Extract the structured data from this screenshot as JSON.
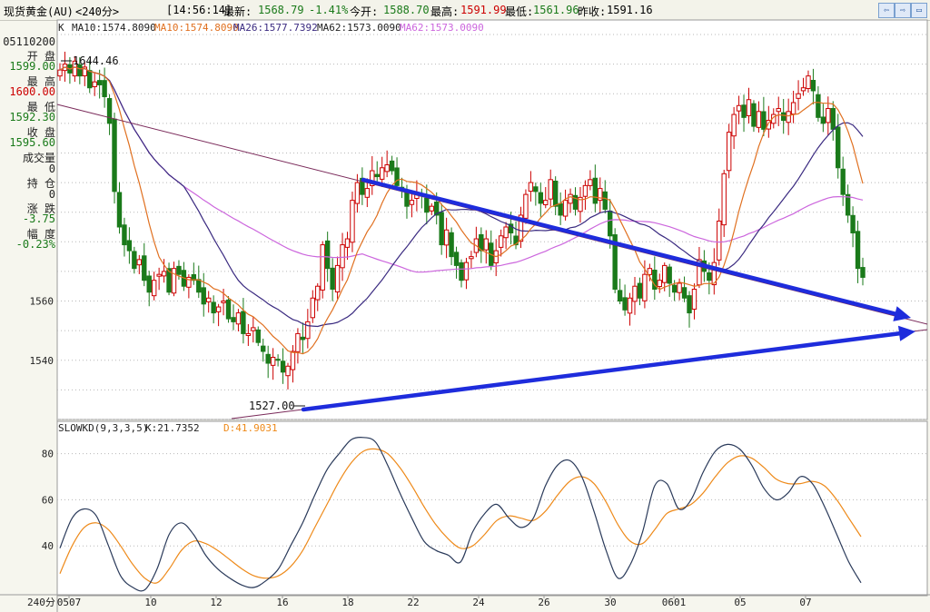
{
  "header": {
    "symbol": "现货黄金(AU)",
    "period": "<240分>",
    "time": "[14:56:14]",
    "latest_label": "最新:",
    "latest_value": "1568.79",
    "change_pct": "-1.41%",
    "open_label": "今开:",
    "open_value": "1588.70",
    "high_label": "最高:",
    "high_value": "1591.99",
    "low_label": "最低:",
    "low_value": "1561.96",
    "prev_label": "昨收:",
    "prev_value": "1591.16",
    "buttons": [
      "⇦",
      "⇨",
      "▭"
    ]
  },
  "info": {
    "date": "05110200",
    "open_label": "开 盘",
    "open": "1599.00",
    "high_label": "最 高",
    "high": "1600.00",
    "low_label": "最 低",
    "low": "1592.30",
    "close_label": "收 盘",
    "close": "1595.60",
    "volume_label": "成交量",
    "volume": "0",
    "position_label": "持 仓",
    "position": "0",
    "change_label": "涨 跌",
    "change": "-3.75",
    "range_label": "幅 度",
    "range": "-0.23%"
  },
  "period_label": "240分",
  "chart_data": [
    {
      "type": "candlestick",
      "legend": [
        {
          "text": "K",
          "color": "#222222"
        },
        {
          "text": "MA10:1574.8090",
          "color": "#222222"
        },
        {
          "text": "MA10:1574.8090",
          "color": "#e07020"
        },
        {
          "text": "MA26:1577.7392",
          "color": "#3a2a80"
        },
        {
          "text": "MA62:1573.0090",
          "color": "#222222"
        },
        {
          "text": "MA62:1573.0090",
          "color": "#cc66dd"
        }
      ],
      "ylim": [
        1520,
        1650
      ],
      "yticks": [
        1540,
        1560
      ],
      "xtick_labels": [
        "0507",
        "10",
        "12",
        "16",
        "18",
        "22",
        "24",
        "26",
        "30",
        "0601",
        "05",
        "07"
      ],
      "max_label": "1644.46",
      "min_label": "1527.00",
      "up_color": "#cc0000",
      "down_color": "#1a7a1a",
      "closes": [
        1638,
        1640,
        1637,
        1641,
        1636,
        1639,
        1632,
        1634,
        1633,
        1629,
        1620,
        1597,
        1585,
        1579,
        1577,
        1571,
        1574,
        1567,
        1563,
        1567,
        1569,
        1570,
        1563,
        1571,
        1569,
        1565,
        1568,
        1567,
        1563,
        1559,
        1561,
        1556,
        1558,
        1560,
        1554,
        1553,
        1556,
        1549,
        1549,
        1551,
        1546,
        1543,
        1539,
        1541,
        1540,
        1536,
        1538,
        1543,
        1549,
        1547,
        1553,
        1561,
        1565,
        1579,
        1571,
        1564,
        1572,
        1579,
        1581,
        1594,
        1600,
        1596,
        1598,
        1604,
        1602,
        1605,
        1606,
        1604,
        1599,
        1598,
        1592,
        1594,
        1596,
        1596,
        1590,
        1592,
        1589,
        1579,
        1584,
        1575,
        1572,
        1567,
        1573,
        1575,
        1581,
        1577,
        1581,
        1572,
        1577,
        1582,
        1585,
        1583,
        1579,
        1589,
        1596,
        1600,
        1597,
        1593,
        1594,
        1601,
        1592,
        1589,
        1594,
        1596,
        1591,
        1595,
        1599,
        1601,
        1593,
        1598,
        1591,
        1582,
        1564,
        1560,
        1557,
        1561,
        1565,
        1561,
        1569,
        1571,
        1564,
        1567,
        1572,
        1566,
        1563,
        1566,
        1561,
        1556,
        1564,
        1574,
        1570,
        1567,
        1573,
        1587,
        1603,
        1617,
        1623,
        1626,
        1622,
        1628,
        1619,
        1624,
        1618,
        1621,
        1623,
        1625,
        1621,
        1624,
        1627,
        1630,
        1632,
        1636,
        1631,
        1622,
        1620,
        1625,
        1618,
        1605,
        1596,
        1589,
        1583,
        1571,
        1568
      ],
      "ma10_color": "#e07020",
      "ma26_color": "#3a2a80",
      "ma62_color": "#cc66dd",
      "trend_color": "#1e2cdc",
      "midline_color": "#7a2a5a"
    },
    {
      "type": "line",
      "title": "SLOWKD(9,3,3,5)",
      "k_label": "K:21.7352",
      "d_label": "D:41.9031",
      "k_color": "#2a3a5a",
      "d_color": "#ee8a1a",
      "ylim": [
        20,
        94
      ],
      "yticks": [
        40,
        60,
        80
      ],
      "k": [
        39,
        52,
        56,
        53,
        40,
        27,
        22,
        21,
        30,
        45,
        50,
        45,
        36,
        30,
        26,
        23,
        22,
        25,
        30,
        40,
        50,
        62,
        73,
        80,
        86,
        87,
        85,
        75,
        63,
        52,
        42,
        38,
        36,
        33,
        46,
        54,
        58,
        52,
        48,
        52,
        66,
        75,
        77,
        70,
        55,
        38,
        26,
        32,
        46,
        66,
        67,
        56,
        60,
        72,
        81,
        84,
        82,
        75,
        65,
        60,
        63,
        70,
        67,
        57,
        45,
        33,
        24
      ],
      "d": [
        28,
        40,
        48,
        50,
        47,
        40,
        32,
        26,
        24,
        30,
        38,
        42,
        41,
        38,
        34,
        30,
        27,
        26,
        27,
        31,
        38,
        48,
        58,
        68,
        76,
        81,
        82,
        80,
        74,
        66,
        57,
        49,
        43,
        39,
        40,
        45,
        51,
        53,
        52,
        51,
        55,
        62,
        68,
        70,
        67,
        59,
        49,
        42,
        41,
        47,
        54,
        56,
        58,
        63,
        70,
        76,
        79,
        78,
        74,
        69,
        67,
        67,
        68,
        66,
        60,
        52,
        44
      ]
    }
  ]
}
